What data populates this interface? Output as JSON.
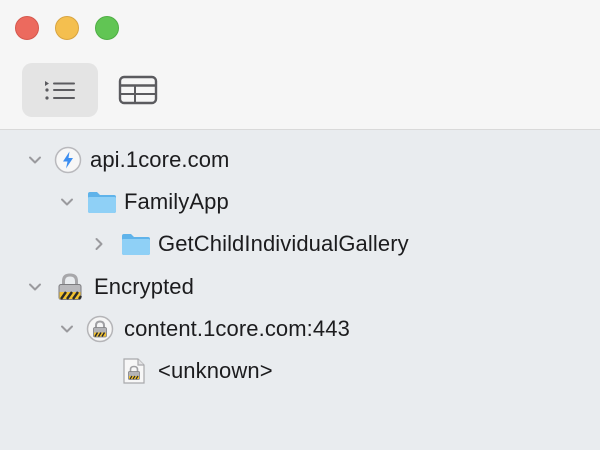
{
  "window": {
    "controls": [
      "close",
      "minimize",
      "maximize"
    ]
  },
  "toolbar": {
    "view_modes": [
      {
        "name": "list-view",
        "icon": "list-icon",
        "selected": true
      },
      {
        "name": "table-view",
        "icon": "table-icon",
        "selected": false
      }
    ]
  },
  "tree": {
    "items": [
      {
        "label": "api.1core.com",
        "icon": "lightning-bolt-icon",
        "expanded": true,
        "level": 0
      },
      {
        "label": "FamilyApp",
        "icon": "folder-icon",
        "expanded": true,
        "level": 1
      },
      {
        "label": "GetChildIndividualGallery",
        "icon": "folder-icon",
        "expanded": false,
        "level": 2
      },
      {
        "label": "Encrypted",
        "icon": "padlock-icon",
        "expanded": true,
        "level": 0
      },
      {
        "label": "content.1core.com:443",
        "icon": "lock-badge-icon",
        "expanded": true,
        "level": 1
      },
      {
        "label": "<unknown>",
        "icon": "locked-file-icon",
        "expanded": null,
        "level": 2
      }
    ]
  },
  "colors": {
    "accent_blue": "#3d8ef0",
    "folder_blue": "#79c6f3",
    "titlebar_bg": "#f6f6f6",
    "sidebar_bg": "#e9ecef"
  }
}
